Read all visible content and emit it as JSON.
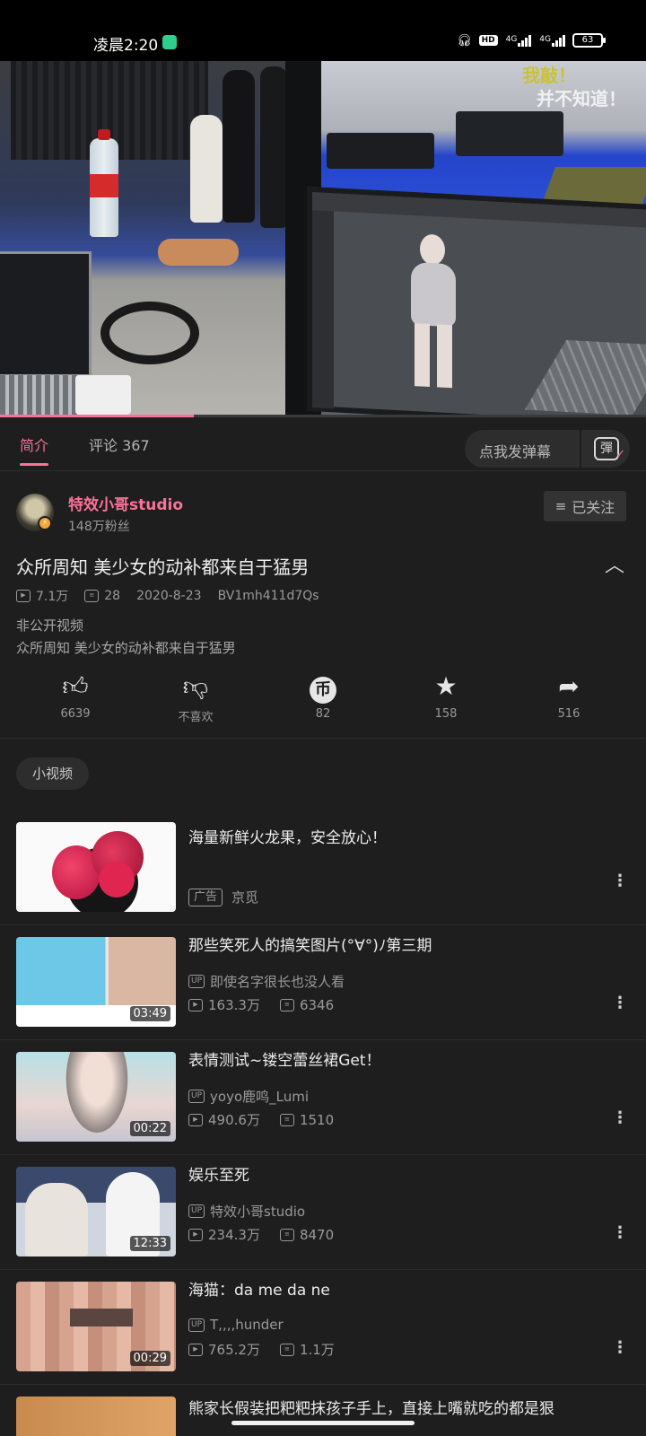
{
  "status_bar": {
    "time": "凌晨2:20",
    "hd": "HD",
    "net1": "4G",
    "net2": "4G",
    "battery": "63"
  },
  "player": {
    "overlay_line1": "我敲！",
    "overlay_line2": "并不知道！",
    "progress": 0.3,
    "accent_color": "#fb7299"
  },
  "tabs": {
    "intro": "简介",
    "comments": "评论 367",
    "danmaku_placeholder": "点我发弹幕",
    "danmaku_icon_label": "彈"
  },
  "uploader": {
    "name": "特效小哥studio",
    "fans": "148万粉丝",
    "follow_label": "已关注"
  },
  "video": {
    "title": "众所周知 美少女的动补都来自于猛男",
    "views": "7.1万",
    "danmaku_count": "28",
    "date": "2020-8-23",
    "bvid": "BV1mh411d7Qs",
    "visibility": "非公开视频",
    "description": "众所周知 美少女的动补都来自于猛男"
  },
  "actions": {
    "like": "6639",
    "dislike": "不喜欢",
    "coin": "82",
    "favorite": "158",
    "share": "516"
  },
  "section_chip": "小视频",
  "recommendations": [
    {
      "title": "海量新鲜火龙果，安全放心！",
      "ad_tag": "广告",
      "advertiser": "京觅"
    },
    {
      "title": "那些笑死人的搞笑图片(°∀°)ﾉ第三期",
      "up": "即使名字很长也没人看",
      "views": "163.3万",
      "danmaku": "6346",
      "duration": "03:49"
    },
    {
      "title": "表情测试~镂空蕾丝裙Get！",
      "up": "yoyo鹿鸣_Lumi",
      "views": "490.6万",
      "danmaku": "1510",
      "duration": "00:22"
    },
    {
      "title": "娱乐至死",
      "up": "特效小哥studio",
      "views": "234.3万",
      "danmaku": "8470",
      "duration": "12:33"
    },
    {
      "title": "海猫：da me da ne",
      "up": "T,,,,hunder",
      "views": "765.2万",
      "danmaku": "1.1万",
      "duration": "00:29"
    },
    {
      "title": "熊家长假装把粑粑抹孩子手上，直接上嘴就吃的都是狠"
    }
  ]
}
